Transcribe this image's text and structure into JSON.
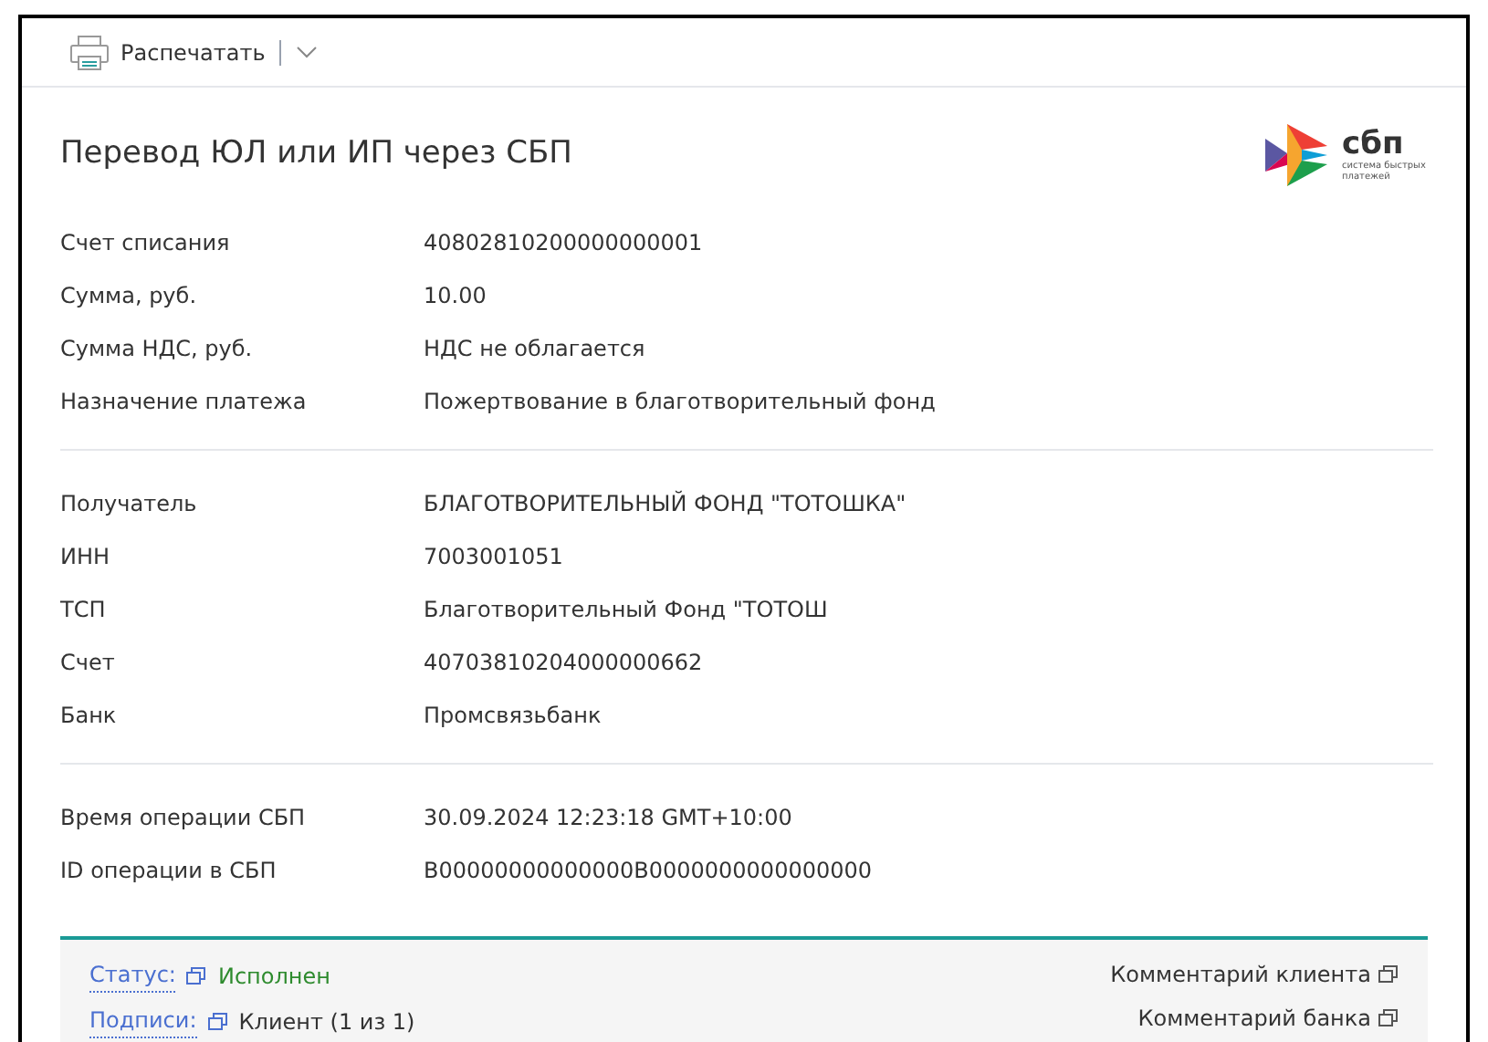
{
  "toolbar": {
    "print_label": "Распечатать"
  },
  "title": "Перевод ЮЛ или ИП через СБП",
  "logo": {
    "wordmark": "сбп",
    "tagline": "система быстрых платежей"
  },
  "sections": [
    {
      "fields": [
        {
          "label": "Счет списания",
          "value": "40802810200000000001"
        },
        {
          "label": "Сумма, руб.",
          "value": "10.00"
        },
        {
          "label": "Сумма НДС, руб.",
          "value": "НДС не облагается"
        },
        {
          "label": "Назначение платежа",
          "value": "Пожертвование в благотворительный фонд"
        }
      ]
    },
    {
      "fields": [
        {
          "label": "Получатель",
          "value": "БЛАГОТВОРИТЕЛЬНЫЙ ФОНД \"ТОТОШКА\""
        },
        {
          "label": "ИНН",
          "value": "7003001051"
        },
        {
          "label": "ТСП",
          "value": "Благотворительный Фонд \"ТОТОШ"
        },
        {
          "label": "Счет",
          "value": "40703810204000000662"
        },
        {
          "label": "Банк",
          "value": "Промсвязьбанк"
        }
      ]
    },
    {
      "fields": [
        {
          "label": "Время операции СБП",
          "value": "30.09.2024 12:23:18 GMT+10:00"
        },
        {
          "label": "ID операции в СБП",
          "value": "B00000000000000B0000000000000000"
        }
      ]
    }
  ],
  "footer": {
    "status_link": "Статус:",
    "status_value": "Исполнен",
    "signatures_link": "Подписи:",
    "signatures_value": "Клиент (1 из 1)",
    "client_comment": "Комментарий клиента",
    "bank_comment": "Комментарий банка"
  }
}
